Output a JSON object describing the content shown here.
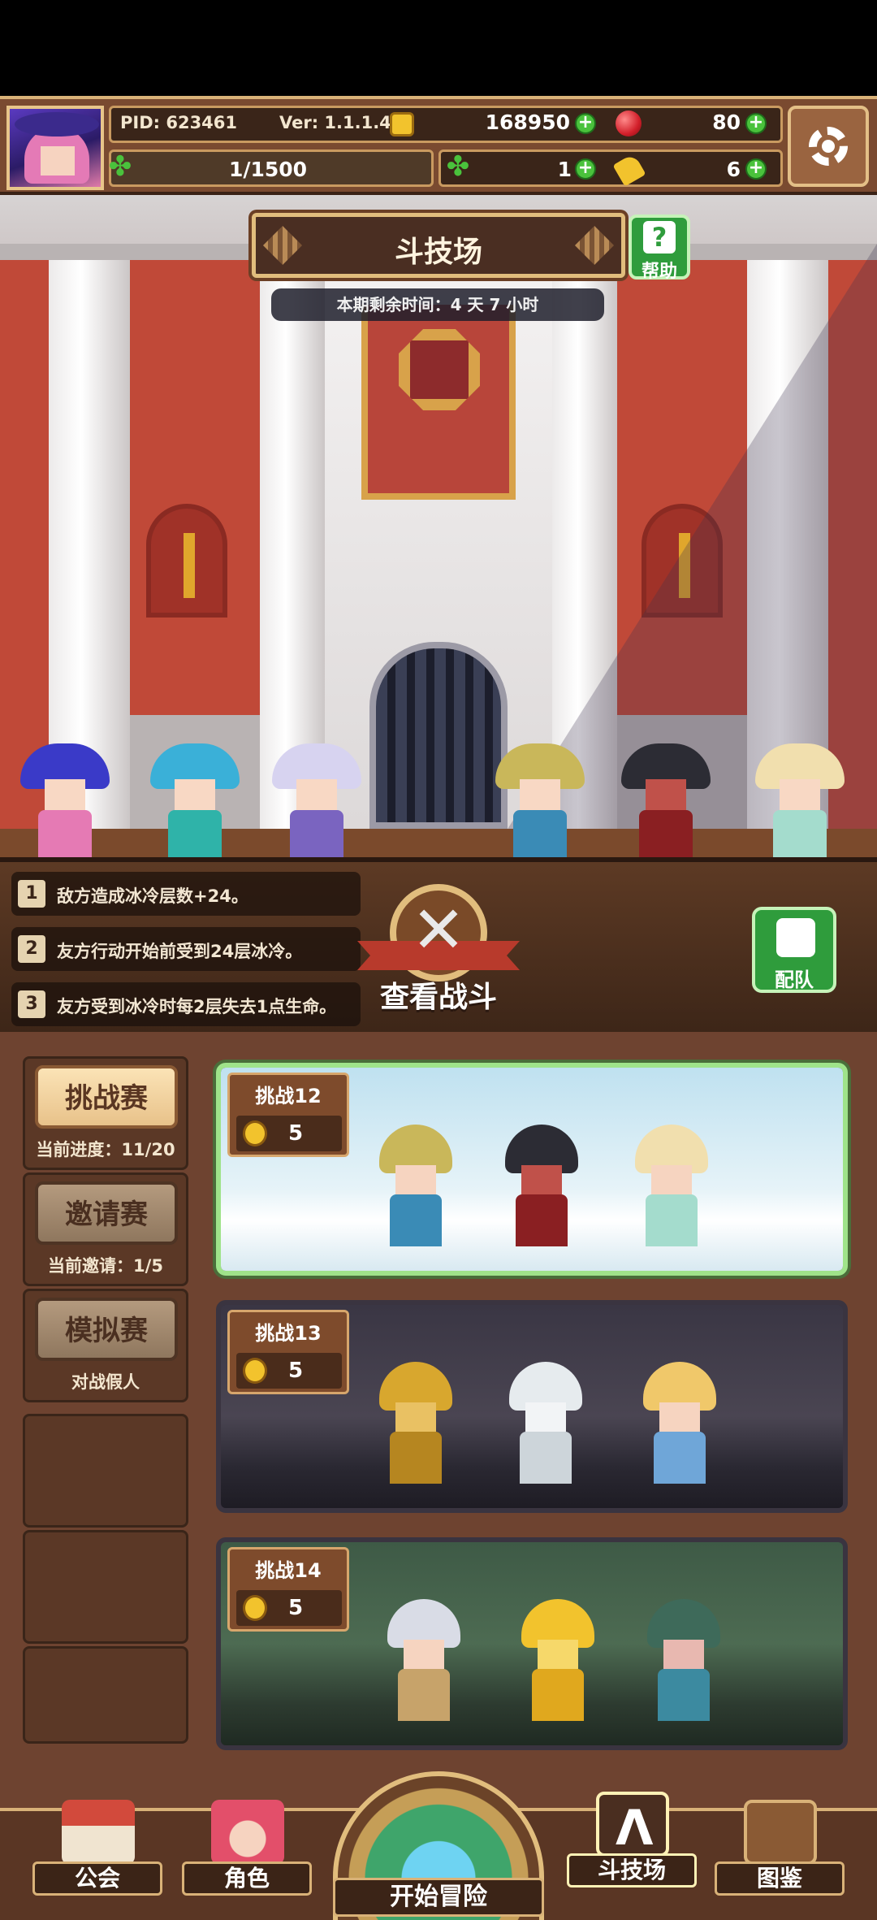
{
  "status_bar": {
    "pid": "PID: 623461",
    "version": "Ver: 1.1.1.4",
    "gold": "168950",
    "ruby": "80",
    "stamina": "1/1500",
    "clover": "1",
    "keys": "6"
  },
  "arena": {
    "title": "斗技场",
    "help_label": "帮助",
    "timer": "本期剩余时间：4 天 7 小时"
  },
  "rules": [
    {
      "index": "1",
      "text": "敌方造成冰冷层数+24。"
    },
    {
      "index": "2",
      "text": "友方行动开始前受到24层冰冷。"
    },
    {
      "index": "3",
      "text": "友方受到冰冷时每2层失去1点生命。"
    }
  ],
  "actions": {
    "view_battle": "查看战斗",
    "team": "配队"
  },
  "modes": [
    {
      "label": "挑战赛",
      "sub": "当前进度：11/20",
      "active": true
    },
    {
      "label": "邀请赛",
      "sub": "当前邀请：1/5",
      "active": false
    },
    {
      "label": "模拟赛",
      "sub": "对战假人",
      "active": false
    }
  ],
  "challenges": [
    {
      "title": "挑战12",
      "cost": "5"
    },
    {
      "title": "挑战13",
      "cost": "5"
    },
    {
      "title": "挑战14",
      "cost": "5"
    }
  ],
  "nav": {
    "guild": "公会",
    "character": "角色",
    "adventure": "开始冒险",
    "arena": "斗技场",
    "codex": "图鉴"
  },
  "colors": {
    "accent_gold": "#e1bd7d",
    "button_green": "#2f9c3c",
    "active_card_border": "#9fe38a"
  }
}
